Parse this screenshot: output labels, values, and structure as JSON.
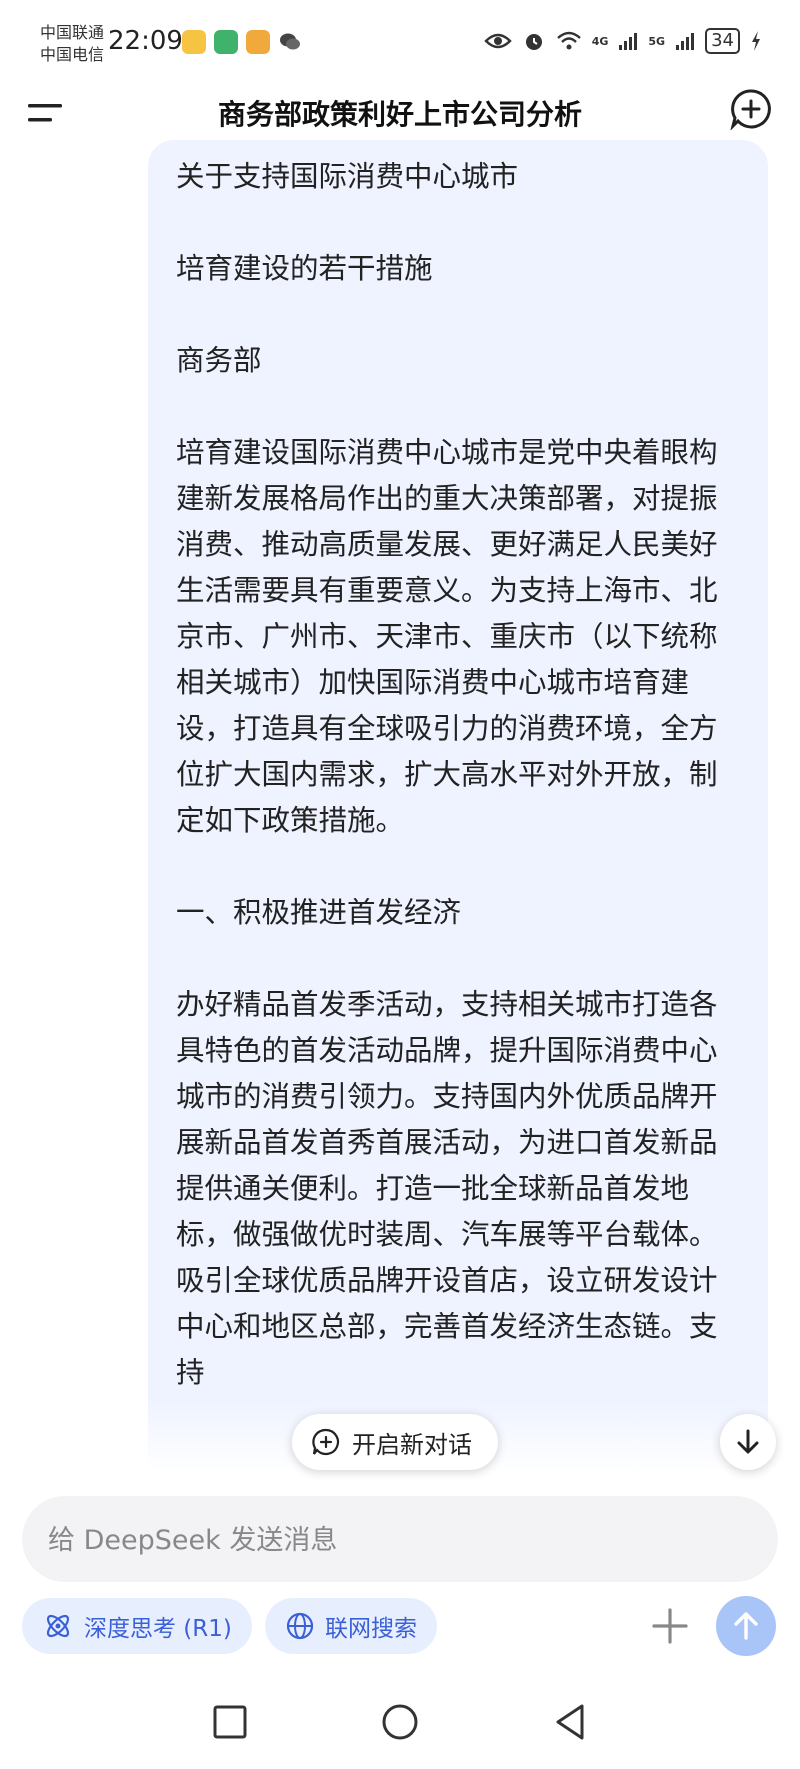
{
  "status_bar": {
    "carrier_1": "中国联通",
    "carrier_2": "中国电信",
    "time": "22:09",
    "signal_1": "4G",
    "signal_2": "5G",
    "battery": "34",
    "app_icons": [
      "notification-app-icon",
      "map-app-icon",
      "shopping-app-icon",
      "wechat-icon"
    ],
    "right_icons": [
      "eye-icon",
      "alarm-icon",
      "wifi-icon",
      "signal-icon",
      "battery-icon",
      "charging-icon"
    ]
  },
  "header": {
    "title": "商务部政策利好上市公司分析"
  },
  "message": {
    "paragraphs": [
      "关于支持国际消费中心城市",
      "培育建设的若干措施",
      "商务部",
      "培育建设国际消费中心城市是党中央着眼构建新发展格局作出的重大决策部署，对提振消费、推动高质量发展、更好满足人民美好生活需要具有重要意义。为支持上海市、北京市、广州市、天津市、重庆市（以下统称相关城市）加快国际消费中心城市培育建设，打造具有全球吸引力的消费环境，全方位扩大国内需求，扩大高水平对外开放，制定如下政策措施。",
      "一、积极推进首发经济",
      "办好精品首发季活动，支持相关城市打造各具特色的首发活动品牌，提升国际消费中心城市的消费引领力。支持国内外优质品牌开展新品首发首秀首展活动，为进口首发新品提供通关便利。打造一批全球新品首发地标，做强做优时装周、汽车展等平台载体。吸引全球优质品牌开设首店，设立研发设计中心和地区总部，完善首发经济生态链。支持"
    ]
  },
  "floating": {
    "new_chat_label": "开启新对话"
  },
  "composer": {
    "placeholder": "给 DeepSeek 发送消息",
    "value": ""
  },
  "chips": {
    "deep_think": "深度思考 (R1)",
    "web_search": "联网搜索"
  },
  "colors": {
    "bubble_bg": "#eef3ff",
    "accent": "#3b5fd6",
    "chip_bg": "#e7efff",
    "send_disabled": "#a9c4f7"
  }
}
